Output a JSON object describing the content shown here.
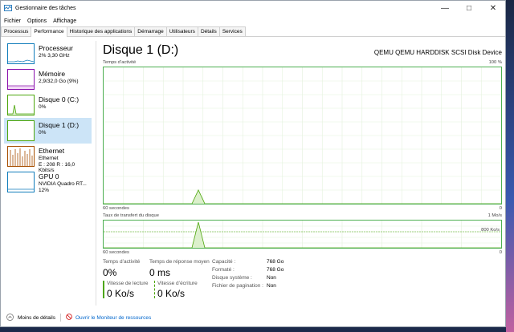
{
  "window": {
    "title": "Gestionnaire des tâches"
  },
  "menu": [
    "Fichier",
    "Options",
    "Affichage"
  ],
  "tabs": [
    "Processus",
    "Performance",
    "Historique des applications",
    "Démarrage",
    "Utilisateurs",
    "Détails",
    "Services"
  ],
  "sidebar": [
    {
      "name": "Processeur",
      "sub": "2% 3,30 GHz",
      "color": "#117dbb"
    },
    {
      "name": "Mémoire",
      "sub": "2,9/32,0 Go (9%)",
      "color": "#8b12ae"
    },
    {
      "name": "Disque 0 (C:)",
      "sub": "0%",
      "color": "#4da60c"
    },
    {
      "name": "Disque 1 (D:)",
      "sub": "0%",
      "color": "#4da60c"
    },
    {
      "name": "Ethernet",
      "sub": "Ethernet",
      "sub2": "E : 208 R : 16,0 Kbits/s",
      "color": "#a74f01"
    },
    {
      "name": "GPU 0",
      "sub": "NVIDIA Quadro RT...",
      "sub2": "12%",
      "color": "#117dbb"
    }
  ],
  "main": {
    "title": "Disque 1 (D:)",
    "model": "QEMU QEMU HARDDISK SCSI Disk Device",
    "activity_label": "Temps d’activité",
    "activity_max": "100 %",
    "seconds_label": "60 secondes",
    "zero": "0",
    "transfer_label": "Taux de transfert du disque",
    "transfer_max": "1 Mo/s",
    "transfer_mid": "800 Ko/s"
  },
  "stats": {
    "active_time_label": "Temps d’activité",
    "active_time": "0%",
    "response_label": "Temps de réponse moyen",
    "response": "0 ms",
    "read_label": "Vitesse de lecture",
    "read": "0 Ko/s",
    "write_label": "Vitesse d’écriture",
    "write": "0 Ko/s",
    "capacity_label": "Capacité :",
    "capacity": "768 Go",
    "formatted_label": "Formaté :",
    "formatted": "768 Go",
    "system_label": "Disque système :",
    "system": "Non",
    "pagefile_label": "Fichier de pagination :",
    "pagefile": "Non"
  },
  "footer": {
    "less": "Moins de détails",
    "monitor": "Ouvrir le Moniteur de ressources"
  }
}
